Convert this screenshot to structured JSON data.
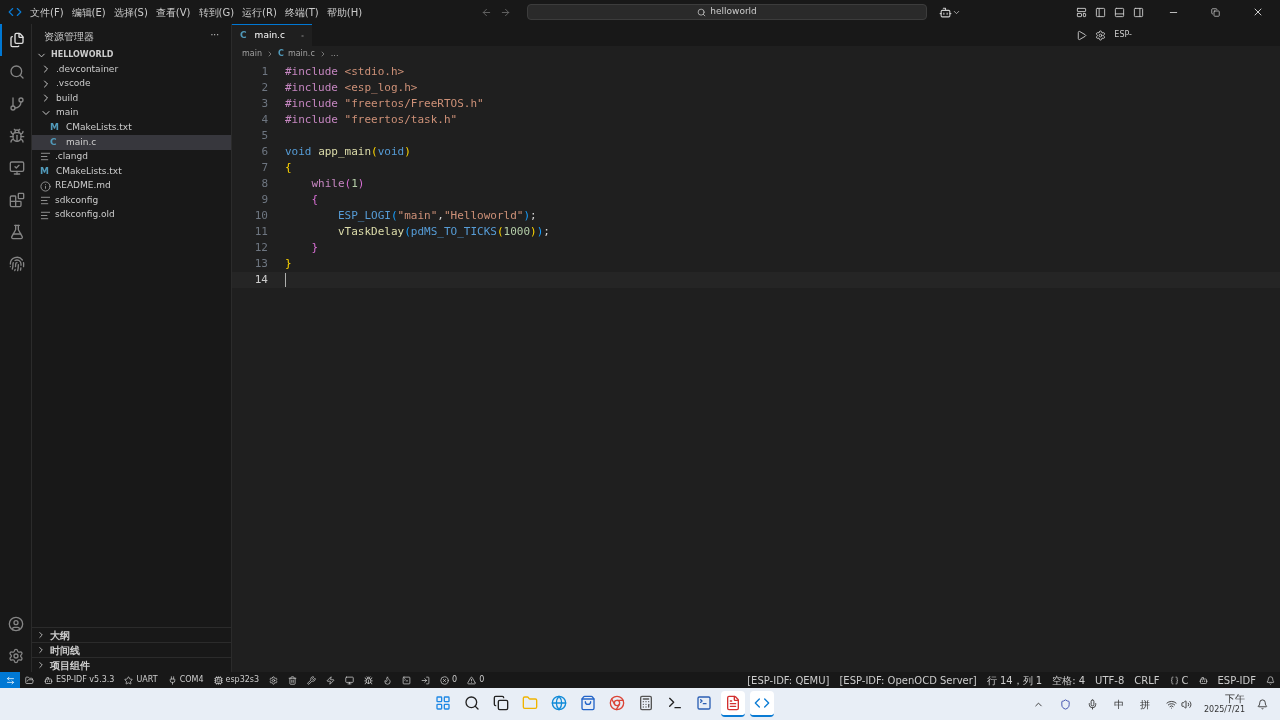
{
  "menu": [
    "文件(F)",
    "编辑(E)",
    "选择(S)",
    "查看(V)",
    "转到(G)",
    "运行(R)",
    "终端(T)",
    "帮助(H)"
  ],
  "search": {
    "value": "helloworld"
  },
  "activity_bar": [
    {
      "kind": "files",
      "selected": true
    },
    {
      "kind": "search",
      "selected": false
    },
    {
      "kind": "git",
      "selected": false
    },
    {
      "kind": "run",
      "selected": false
    },
    {
      "kind": "remote",
      "selected": false
    },
    {
      "kind": "extensions",
      "selected": false
    },
    {
      "kind": "flask",
      "selected": false
    },
    {
      "kind": "idf",
      "selected": false
    }
  ],
  "sidebar": {
    "title": "资源管理器",
    "more": "···",
    "root": "HELLOWORLD",
    "tree": [
      {
        "name": ".devcontainer",
        "kind": "folder",
        "expanded": false,
        "selected": false
      },
      {
        "name": ".vscode",
        "kind": "folder",
        "expanded": false,
        "selected": false
      },
      {
        "name": "build",
        "kind": "folder",
        "expanded": false,
        "selected": false
      },
      {
        "name": "main",
        "kind": "folder",
        "expanded": true,
        "selected": false,
        "children": [
          {
            "name": "CMakeLists.txt",
            "kind": "file",
            "icon": "M",
            "selected": false
          },
          {
            "name": "main.c",
            "kind": "file",
            "icon": "C",
            "selected": true
          }
        ]
      },
      {
        "name": ".clangd",
        "kind": "config",
        "selected": false
      },
      {
        "name": "CMakeLists.txt",
        "kind": "file",
        "icon": "M",
        "selected": false
      },
      {
        "name": "README.md",
        "kind": "info",
        "selected": false
      },
      {
        "name": "sdkconfig",
        "kind": "config",
        "selected": false
      },
      {
        "name": "sdkconfig.old",
        "kind": "config",
        "selected": false
      }
    ],
    "sections": [
      "大纲",
      "时间线",
      "项目组件"
    ]
  },
  "tab": {
    "icon": "C",
    "label": "main.c"
  },
  "breadcrumbs": [
    {
      "label": "main"
    },
    {
      "label": "main.c",
      "icon": "C"
    },
    {
      "label": "..."
    }
  ],
  "editor_actions": {
    "label": "ESP-"
  },
  "code": [
    {
      "number": "1",
      "active": false,
      "tokens": [
        {
          "text": "#include ",
          "kind": "pre"
        },
        {
          "text": "<stdio.h>",
          "kind": "str"
        }
      ]
    },
    {
      "number": "2",
      "active": false,
      "tokens": [
        {
          "text": "#include ",
          "kind": "pre"
        },
        {
          "text": "<esp_log.h>",
          "kind": "str"
        }
      ]
    },
    {
      "number": "3",
      "active": false,
      "tokens": [
        {
          "text": "#include ",
          "kind": "pre"
        },
        {
          "text": "\"freertos/FreeRTOS.h\"",
          "kind": "str"
        }
      ]
    },
    {
      "number": "4",
      "active": false,
      "tokens": [
        {
          "text": "#include ",
          "kind": "pre"
        },
        {
          "text": "\"freertos/task.h\"",
          "kind": "str"
        }
      ]
    },
    {
      "number": "5",
      "active": false
    },
    {
      "number": "6",
      "active": false,
      "tokens": [
        {
          "text": "void ",
          "kind": "type"
        },
        {
          "text": "app_main",
          "kind": "fn"
        },
        {
          "text": "(",
          "kind": "b1"
        },
        {
          "text": "void",
          "kind": "type"
        },
        {
          "text": ")",
          "kind": "b1"
        }
      ]
    },
    {
      "number": "7",
      "active": false,
      "tokens": [
        {
          "text": "{",
          "kind": "b1"
        }
      ]
    },
    {
      "number": "8",
      "active": false,
      "tokens": [
        {
          "text": "    while",
          "kind": "pre"
        },
        {
          "text": "(",
          "kind": "b2"
        },
        {
          "text": "1",
          "kind": "num"
        },
        {
          "text": ")",
          "kind": "b2"
        }
      ]
    },
    {
      "number": "9",
      "active": false,
      "tokens": [
        {
          "text": "    {",
          "kind": "b2"
        }
      ]
    },
    {
      "number": "10",
      "active": false,
      "tokens": [
        {
          "text": "        ESP_LOGI",
          "kind": "type"
        },
        {
          "text": "(",
          "kind": "b3"
        },
        {
          "text": "\"main\"",
          "kind": "str"
        },
        {
          "text": ",",
          "kind": "plain"
        },
        {
          "text": "\"Helloworld\"",
          "kind": "str"
        },
        {
          "text": ")",
          "kind": "b3"
        },
        {
          "text": ";",
          "kind": "plain"
        }
      ]
    },
    {
      "number": "11",
      "active": false,
      "tokens": [
        {
          "text": "        vTaskDelay",
          "kind": "fn"
        },
        {
          "text": "(",
          "kind": "b3"
        },
        {
          "text": "pdMS_TO_TICKS",
          "kind": "type"
        },
        {
          "text": "(",
          "kind": "b1"
        },
        {
          "text": "1000",
          "kind": "num"
        },
        {
          "text": ")",
          "kind": "b1"
        },
        {
          "text": ")",
          "kind": "b3"
        },
        {
          "text": ";",
          "kind": "plain"
        }
      ]
    },
    {
      "number": "12",
      "active": false,
      "tokens": [
        {
          "text": "    }",
          "kind": "b2"
        }
      ]
    },
    {
      "number": "13",
      "active": false,
      "tokens": [
        {
          "text": "}",
          "kind": "b1"
        }
      ]
    },
    {
      "number": "14",
      "active": true
    }
  ],
  "status_left": [
    {
      "kind": "folder"
    },
    {
      "kind": "idf",
      "text": "ESP-IDF v5.3.3"
    },
    {
      "kind": "star",
      "text": "UART"
    },
    {
      "kind": "plug",
      "text": "COM4"
    },
    {
      "kind": "chip",
      "text": "esp32s3"
    },
    {
      "kind": "gear"
    },
    {
      "kind": "trash"
    },
    {
      "kind": "wrench"
    },
    {
      "kind": "flash"
    },
    {
      "kind": "monitor"
    },
    {
      "kind": "debug"
    },
    {
      "kind": "flame"
    },
    {
      "kind": "terminal"
    },
    {
      "kind": "enter"
    },
    {
      "kind": "error",
      "text": "0"
    },
    {
      "kind": "warning",
      "text": "0"
    }
  ],
  "status_right": [
    {
      "kind": "text",
      "text": "[ESP-IDF: QEMU]"
    },
    {
      "kind": "text",
      "text": "[ESP-IDF: OpenOCD Server]"
    },
    {
      "kind": "text",
      "text": "行 14，列 1"
    },
    {
      "kind": "text",
      "text": "空格: 4"
    },
    {
      "kind": "text",
      "text": "UTF-8"
    },
    {
      "kind": "text",
      "text": "CRLF"
    },
    {
      "kind": "braces",
      "text": "C"
    },
    {
      "kind": "bot"
    },
    {
      "kind": "text",
      "text": "ESP-IDF"
    },
    {
      "kind": "bell"
    }
  ],
  "taskbar": {
    "apps": [
      {
        "kind": "start",
        "active": false
      },
      {
        "kind": "search",
        "active": false
      },
      {
        "kind": "taskview",
        "active": false
      },
      {
        "kind": "explorer",
        "active": false
      },
      {
        "kind": "browser",
        "active": false
      },
      {
        "kind": "store",
        "active": false
      },
      {
        "kind": "chrome",
        "active": false
      },
      {
        "kind": "calculator",
        "active": false
      },
      {
        "kind": "terminal",
        "active": false
      },
      {
        "kind": "powershell",
        "active": false
      },
      {
        "kind": "office",
        "active": true
      },
      {
        "kind": "vscode",
        "active": true
      }
    ],
    "ime": [
      "中",
      "拼"
    ],
    "time": "下午",
    "date": "2025/7/21"
  }
}
